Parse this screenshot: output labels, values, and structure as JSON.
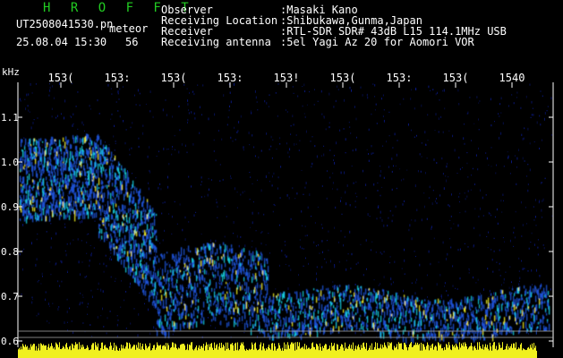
{
  "header": {
    "software_title": "H R O F F T",
    "file_name": "UT2508041530.pn",
    "file_tag": "meteor",
    "date_time": "25.08.04 15:30",
    "count": "56"
  },
  "info": [
    {
      "label": "Observer",
      "value": ":Masaki Kano"
    },
    {
      "label": "Receiving Location",
      "value": ":Shibukawa,Gunma,Japan"
    },
    {
      "label": "Receiver",
      "value": ":RTL-SDR SDR# 43dB L15 114.1MHz USB"
    },
    {
      "label": "Receiving antenna",
      "value": ":5el Yagi Az 20 for Aomori VOR"
    }
  ],
  "axis": {
    "y_unit": "kHz",
    "y_ticks": [
      "1.1",
      "1.0",
      "0.9",
      "0.8",
      "0.7",
      "0.6"
    ],
    "x_ticks": [
      "153(",
      "153:",
      "153(",
      "153:",
      "153!",
      "153(",
      "153:",
      "153(",
      "1540"
    ]
  },
  "colors": {
    "background": "#000000",
    "noise": "#0a1a8a",
    "signal_low": "#1a4fd0",
    "signal_mid": "#14c8d8",
    "signal_high": "#e8e820",
    "noise_band": "#f0f020",
    "label": "#ffffff",
    "title": "#22cc22"
  }
}
